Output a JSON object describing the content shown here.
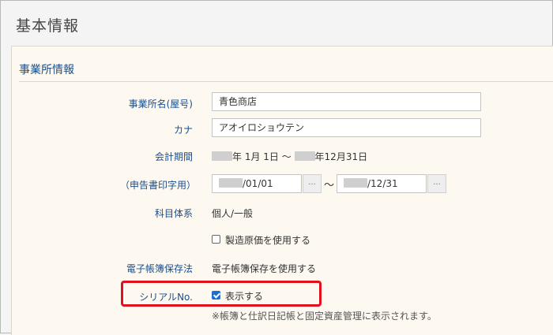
{
  "page": {
    "title": "基本情報"
  },
  "section": {
    "title": "事業所情報"
  },
  "fields": {
    "business_name": {
      "label": "事業所名(屋号)",
      "value": "青色商店"
    },
    "kana": {
      "label": "カナ",
      "value": "アオイロショウテン"
    },
    "fiscal_period": {
      "label": "会計期間",
      "start_suffix": "年 1月 1日 ～",
      "end_suffix": "年12月31日"
    },
    "filing_period": {
      "label": "（申告書印字用）",
      "start_suffix": "/01/01",
      "end_suffix": "/12/31",
      "separator": "～",
      "picker_label": "..."
    },
    "account_system": {
      "label": "科目体系",
      "value": "個人/一般"
    },
    "manufacturing_cost": {
      "label": "製造原価を使用する",
      "checked": false
    },
    "e_book_law": {
      "label": "電子帳簿保存法",
      "value": "電子帳簿保存を使用する"
    },
    "serial_no": {
      "label": "シリアルNo.",
      "checkbox_label": "表示する",
      "checked": true
    }
  },
  "note": "※帳簿と仕訳日記帳と固定資産管理に表示されます。",
  "colors": {
    "label_blue": "#1a4f8b",
    "highlight_red": "#e0111e",
    "checkbox_blue": "#1f6fd0"
  }
}
